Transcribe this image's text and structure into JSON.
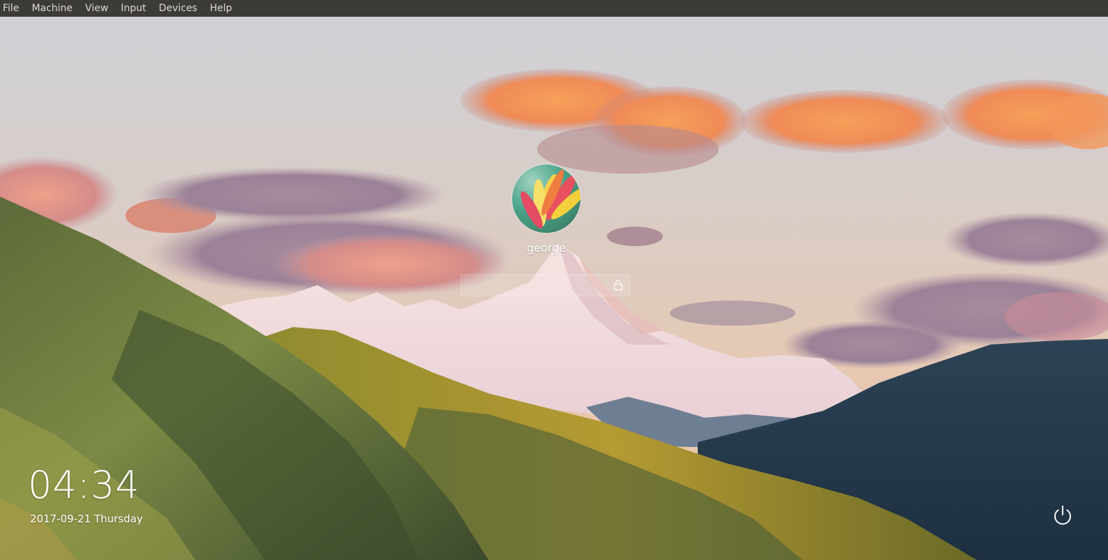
{
  "menubar": {
    "items": [
      {
        "label": "File"
      },
      {
        "label": "Machine"
      },
      {
        "label": "View"
      },
      {
        "label": "Input"
      },
      {
        "label": "Devices"
      },
      {
        "label": "Help"
      }
    ]
  },
  "login": {
    "username": "george",
    "password_value": "",
    "avatar_icon": "flower-avatar",
    "lock_icon": "lock-icon"
  },
  "clock": {
    "time": "04:34",
    "date": "2017-09-21 Thursday"
  },
  "power": {
    "icon": "power-icon"
  },
  "colors": {
    "menubar_bg": "#3c3b37",
    "menubar_text": "#dfdbd2",
    "text": "#ffffff"
  }
}
